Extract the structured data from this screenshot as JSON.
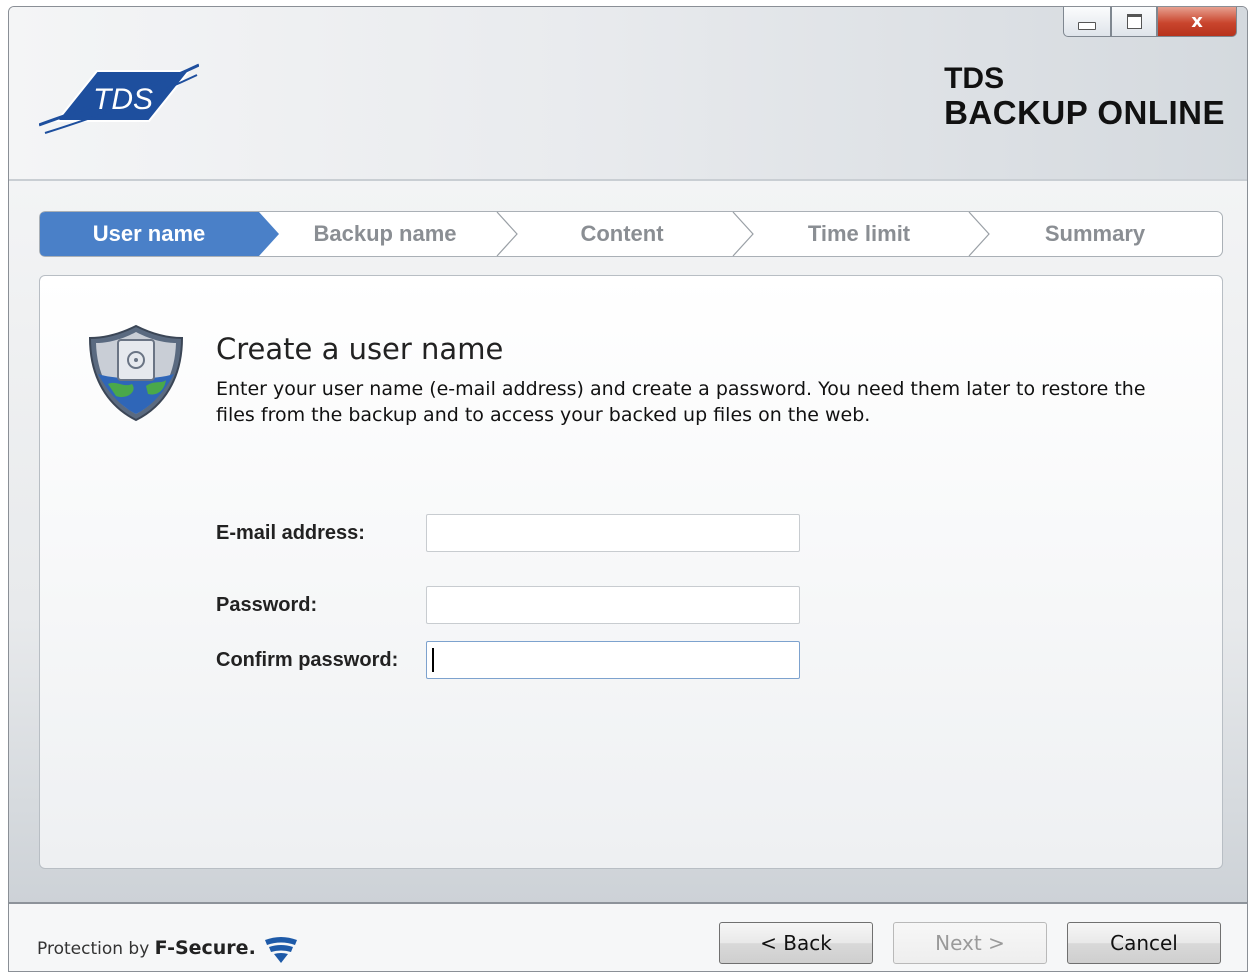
{
  "window": {
    "controls": {
      "close_glyph": "x"
    }
  },
  "brand": {
    "logo_text": "TDS",
    "line1": "TDS",
    "line2": "BACKUP ONLINE"
  },
  "steps": [
    {
      "label": "User name",
      "active": true
    },
    {
      "label": "Backup name",
      "active": false
    },
    {
      "label": "Content",
      "active": false
    },
    {
      "label": "Time limit",
      "active": false
    },
    {
      "label": "Summary",
      "active": false
    }
  ],
  "panel": {
    "title": "Create a user name",
    "description": "Enter your user name (e-mail address) and create a password. You need them later to restore the files from the backup and to access your backed up files on the web.",
    "fields": {
      "email_label": "E-mail address:",
      "email_value": "",
      "password_label": "Password:",
      "password_value": "",
      "confirm_label": "Confirm password:",
      "confirm_value": ""
    }
  },
  "footer": {
    "protection_prefix": "Protection by",
    "protection_brand": "F-Secure.",
    "back_label": "< Back",
    "next_label": "Next >",
    "cancel_label": "Cancel"
  },
  "colors": {
    "step_active": "#4a80c8",
    "step_inactive_text": "#8a8e93",
    "logo_blue": "#1e4f9e",
    "close_red": "#c9452d"
  }
}
